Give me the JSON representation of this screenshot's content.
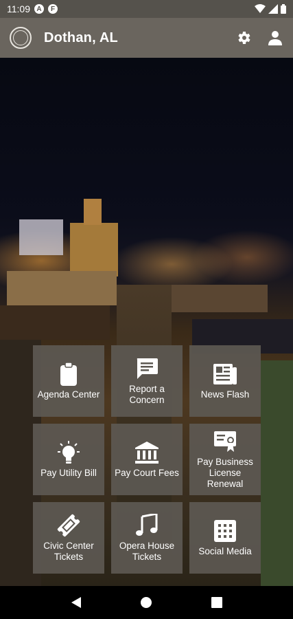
{
  "status_bar": {
    "time": "11:09",
    "notif_icons": [
      "A",
      "F"
    ]
  },
  "app_bar": {
    "title": "Dothan, AL"
  },
  "tiles": [
    {
      "label": "Agenda Center",
      "icon": "clipboard-icon"
    },
    {
      "label": "Report a Concern",
      "icon": "chat-bubble-icon"
    },
    {
      "label": "News Flash",
      "icon": "newspaper-icon"
    },
    {
      "label": "Pay Utility Bill",
      "icon": "lightbulb-icon"
    },
    {
      "label": "Pay Court Fees",
      "icon": "courthouse-icon"
    },
    {
      "label": "Pay Business License Renewal",
      "icon": "certificate-icon"
    },
    {
      "label": "Civic Center Tickets",
      "icon": "ticket-icon"
    },
    {
      "label": "Opera House Tickets",
      "icon": "music-note-icon"
    },
    {
      "label": "Social Media",
      "icon": "apps-grid-icon"
    }
  ]
}
